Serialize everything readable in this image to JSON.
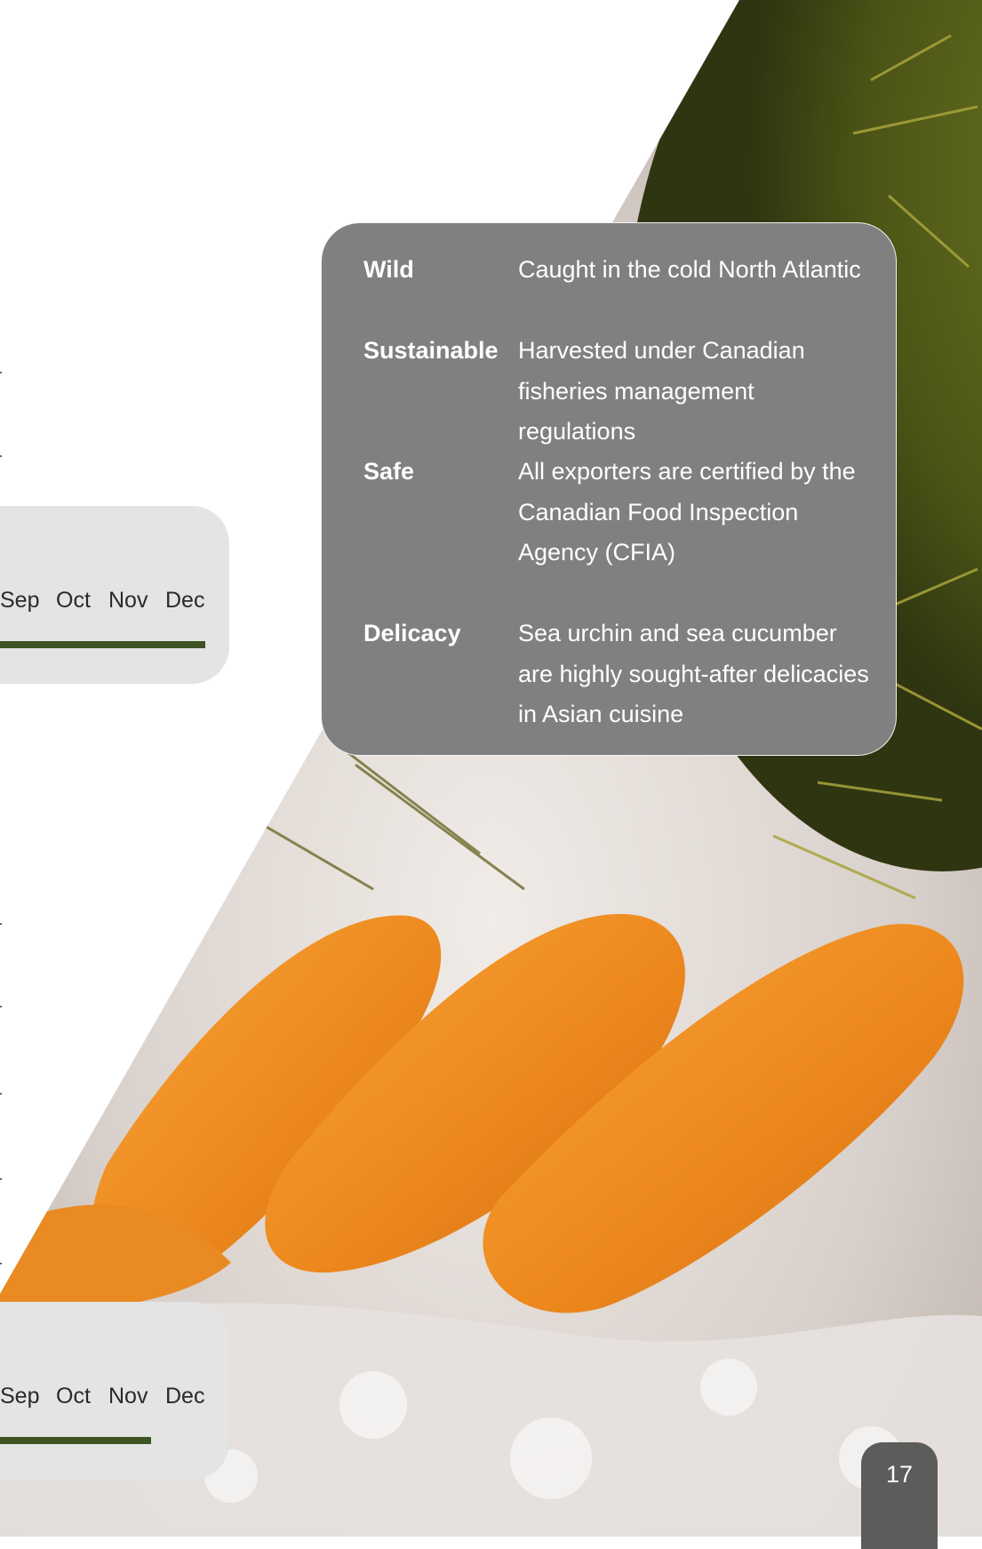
{
  "season_panels": [
    {
      "months": [
        "Sep",
        "Oct",
        "Nov",
        "Dec"
      ]
    },
    {
      "months": [
        "Sep",
        "Oct",
        "Nov",
        "Dec"
      ]
    }
  ],
  "attributes": [
    {
      "term": "Wild",
      "description": "Caught in the cold North Atlantic"
    },
    {
      "term": "Sustainable",
      "description": "Harvested under Canadian fisheries management regulations"
    },
    {
      "term": "Safe",
      "description": "All exporters are certified by the Canadian Food Inspection Agency (CFIA)"
    },
    {
      "term": "Delicacy",
      "description": "Sea urchin and sea cucumber are highly sought-after delicacies in Asian cuisine"
    }
  ],
  "page_number": "17",
  "photo": {
    "subject": "sea urchin roe on crushed ice with sea urchin spines"
  },
  "colors": {
    "card_background": "#7f807f",
    "season_bar": "#3f5424",
    "panel_background": "#e3e4e3",
    "page_tab": "#5c5c5b"
  }
}
